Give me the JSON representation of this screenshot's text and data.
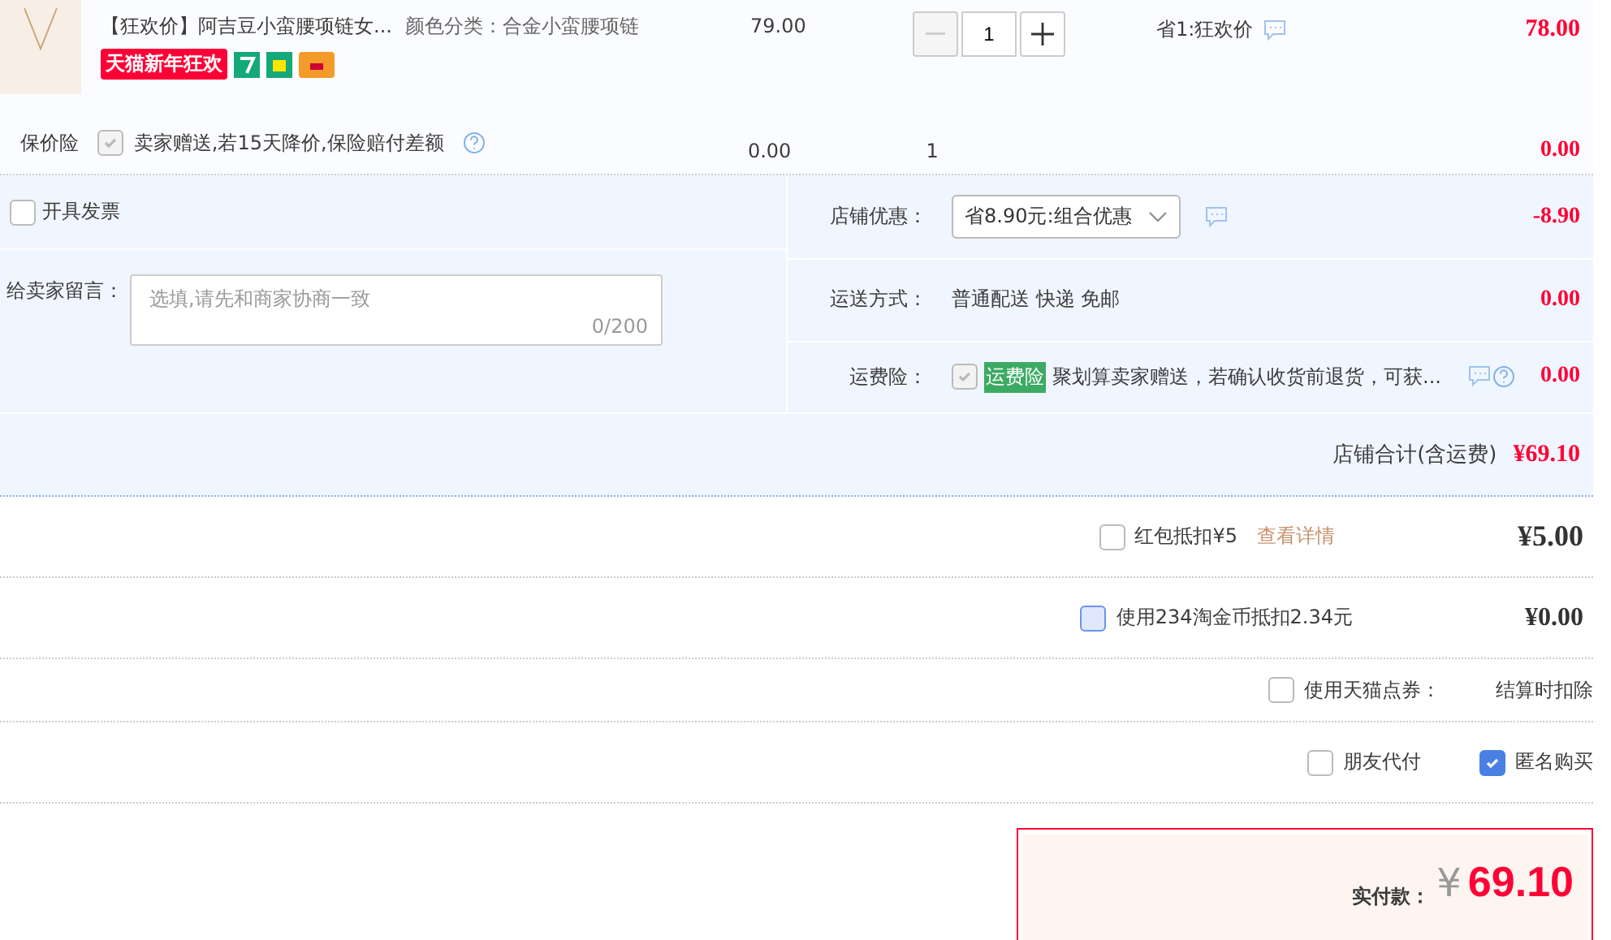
{
  "item": {
    "title": "【狂欢价】阿吉豆小蛮腰项链女...",
    "sku": "颜色分类：合金小蛮腰项链",
    "badge": "天猫新年狂欢",
    "price": "79.00",
    "quantity": "1",
    "minus_disabled": true,
    "promo": "省1:狂欢价",
    "total": "78.00"
  },
  "insurance": {
    "label": "保价险",
    "checked": true,
    "disabled": true,
    "text": "卖家赠送,若15天降价,保险赔付差额",
    "price": "0.00",
    "quantity": "1",
    "total": "0.00"
  },
  "invoice": {
    "label": "开具发票",
    "checked": false
  },
  "message": {
    "label": "给卖家留言：",
    "placeholder": "选填,请先和商家协商一致",
    "counter": "0/200"
  },
  "shop_rows": [
    {
      "kind": "select",
      "label": "店铺优惠：",
      "value": "省8.90元:组合优惠",
      "amount": "-8.90"
    },
    {
      "kind": "text",
      "label": "运送方式：",
      "value": "普通配送 快递 免邮",
      "amount": "0.00"
    },
    {
      "kind": "insurance",
      "label": "运费险：",
      "checked": true,
      "tag": "运费险",
      "value": "聚划算卖家赠送，若确认收货前退货，可获...",
      "amount": "0.00"
    }
  ],
  "shop_total": {
    "label": "店铺合计(含运费)",
    "value": "¥69.10"
  },
  "options": [
    {
      "kind": "redpacket",
      "label": "红包抵扣¥5",
      "checked": false,
      "link": "查看详情",
      "amount": "¥5.00"
    },
    {
      "kind": "coins",
      "label": "使用234淘金币抵扣2.34元",
      "checked": false,
      "amount": "¥0.00"
    },
    {
      "kind": "coupon",
      "label": "使用天猫点券：",
      "checked": false,
      "amount": "结算时扣除"
    },
    {
      "kind": "pair",
      "items": [
        {
          "label": "朋友代付",
          "checked": false
        },
        {
          "label": "匿名购买",
          "checked": true
        }
      ]
    }
  ],
  "payment": {
    "label": "实付款：",
    "currency": "¥",
    "amount": "69.10"
  }
}
